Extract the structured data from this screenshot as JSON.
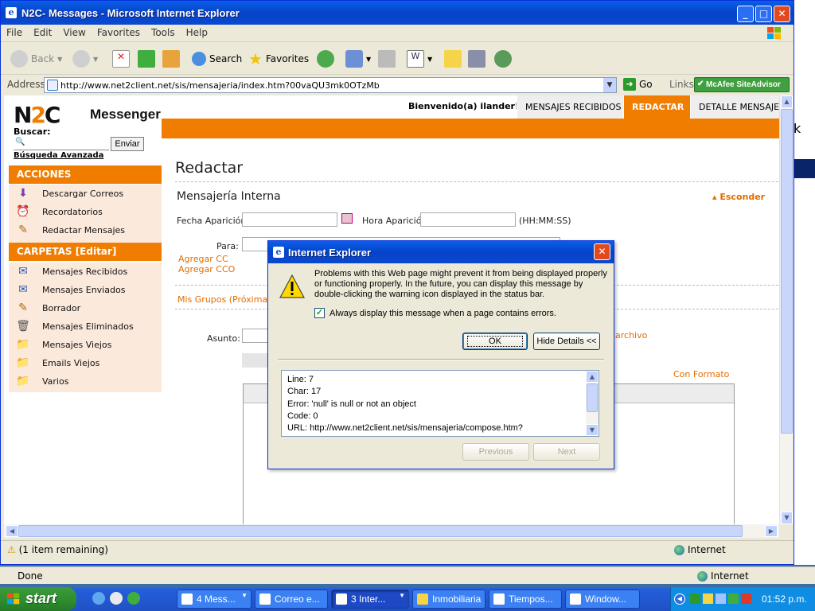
{
  "window": {
    "title": "N2C- Messages - Microsoft Internet Explorer",
    "menu": [
      "File",
      "Edit",
      "View",
      "Favorites",
      "Tools",
      "Help"
    ],
    "toolbar": {
      "back": "Back",
      "search": "Search",
      "favorites": "Favorites"
    },
    "address": {
      "label": "Address",
      "url": "http://www.net2client.net/sis/mensajeria/index.htm?00vaQU3mk0OTzMb",
      "go": "Go",
      "links": "Links",
      "addon": "McAfee SiteAdvisor"
    },
    "status": {
      "text": "(1 item remaining)",
      "zone": "Internet"
    }
  },
  "status2": {
    "text": "Done",
    "zone": "Internet"
  },
  "page": {
    "logo": {
      "brand_a": "N",
      "brand_b": "2",
      "brand_c": "C",
      "name": "Messenger"
    },
    "search": {
      "label": "Buscar:",
      "button": "Enviar",
      "advanced": "Búsqueda Avanzada"
    },
    "welcome": "Bienvenido(a) ilander!",
    "tabs": [
      "MENSAJES RECIBIDOS",
      "REDACTAR",
      "DETALLE MENSAJE"
    ],
    "acciones": {
      "title": "ACCIONES",
      "items": [
        "Descargar Correos",
        "Recordatorios",
        "Redactar Mensajes"
      ]
    },
    "carpetas": {
      "title": "CARPETAS [Editar]",
      "items": [
        "Mensajes Recibidos",
        "Mensajes Enviados",
        "Borrador",
        "Mensajes Eliminados",
        "Mensajes Viejos",
        "Emails Viejos",
        "Varios"
      ]
    },
    "heading": "Redactar",
    "section": "Mensajería Interna",
    "hide": "Esconder",
    "form": {
      "fecha": "Fecha Aparición",
      "hora": "Hora Aparición",
      "hora_hint": "(HH:MM:SS)",
      "para": "Para:",
      "cc": "Agregar CC",
      "cco": "Agregar CCO",
      "grupos": "Mis Grupos (Próximamente)",
      "asunto": "Asunto:",
      "archivo": "archivo",
      "formato": "Con Formato"
    }
  },
  "dialog": {
    "title": "Internet Explorer",
    "message": "Problems with this Web page might prevent it from being displayed properly or functioning properly. In the future, you can display this message by double-clicking the warning icon displayed in the status bar.",
    "checkbox": "Always display this message when a page contains errors.",
    "ok": "OK",
    "hide_details": "Hide Details <<",
    "details": [
      "Line:  7",
      "Char:  17",
      "Error:  'null' is null or not an object",
      "Code: 0",
      "URL:  http://www.net2client.net/sis/mensajeria/compose.htm?"
    ],
    "previous": "Previous",
    "next": "Next"
  },
  "taskbar": {
    "start": "start",
    "tasks": [
      "4 Mess...",
      "Correo e...",
      "3 Inter...",
      "Inmobiliaria",
      "Tiempos...",
      "Window..."
    ],
    "clock": "01:52 p.m."
  },
  "colors": {
    "accent": "#f07d00",
    "sidebar_bg": "#fbe9dc",
    "xp_blue": "#0a49d0"
  }
}
